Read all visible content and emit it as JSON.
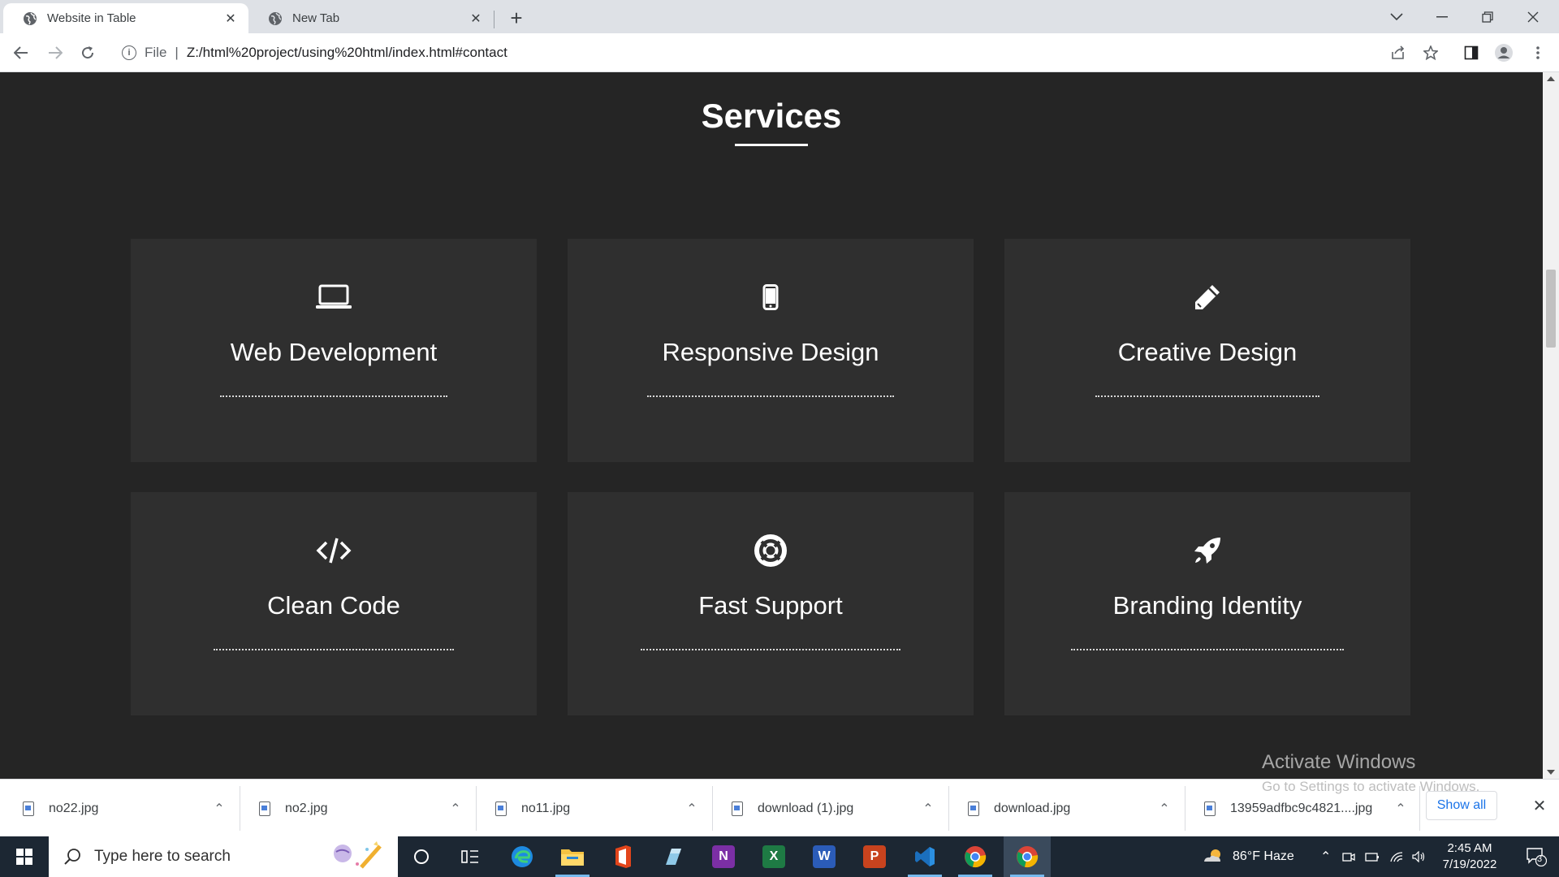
{
  "browser": {
    "tabs": [
      {
        "title": "Website in Table",
        "active": true
      },
      {
        "title": "New Tab",
        "active": false
      }
    ],
    "url": {
      "scheme_label": "File",
      "path": "Z:/html%20project/using%20html/index.html#contact"
    }
  },
  "page": {
    "section_title": "Services",
    "services": [
      {
        "name": "Web Development",
        "icon": "laptop-icon"
      },
      {
        "name": "Responsive Design",
        "icon": "mobile-phone-icon"
      },
      {
        "name": "Creative Design",
        "icon": "pencil-icon"
      },
      {
        "name": "Clean Code",
        "icon": "code-icon"
      },
      {
        "name": "Fast Support",
        "icon": "life-ring-icon"
      },
      {
        "name": "Branding Identity",
        "icon": "rocket-icon"
      }
    ]
  },
  "downloads": {
    "items": [
      "no22.jpg",
      "no2.jpg",
      "no11.jpg",
      "download (1).jpg",
      "download.jpg",
      "13959adfbc9c4821....jpg"
    ],
    "show_all_label": "Show all"
  },
  "watermark": {
    "line1": "Activate Windows",
    "line2": "Go to Settings to activate Windows."
  },
  "taskbar": {
    "search_placeholder": "Type here to search",
    "weather": "86°F  Haze",
    "time": "2:45 AM",
    "date": "7/19/2022",
    "notification_count": "3"
  },
  "colors": {
    "page_background": "#252525",
    "card_background": "#2f2f2f",
    "text": "#ffffff",
    "taskbar": "#1c2733"
  }
}
